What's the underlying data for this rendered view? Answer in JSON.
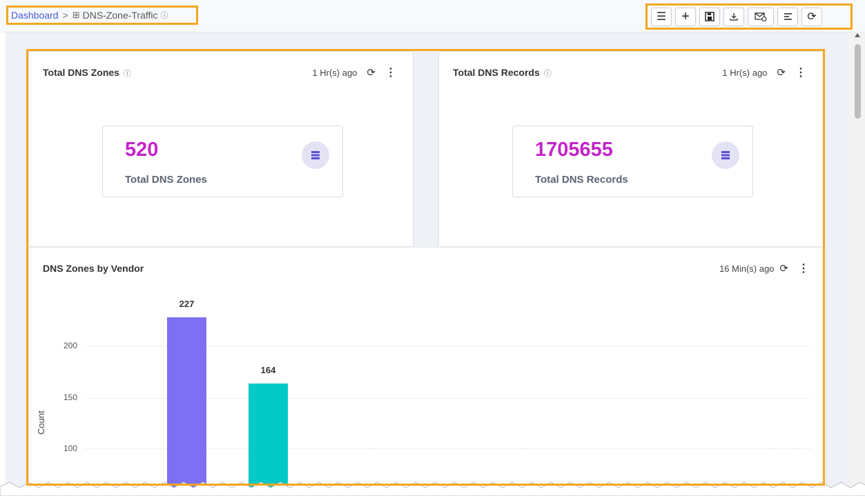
{
  "breadcrumb": {
    "root": "Dashboard",
    "separator": ">",
    "current": "DNS-Zone-Traffic"
  },
  "toolbar": {
    "buttons": [
      "menu-icon",
      "add-icon",
      "save-icon",
      "download-icon",
      "email-schedule-icon",
      "list-icon",
      "refresh-icon"
    ]
  },
  "cards": [
    {
      "title": "Total DNS Zones",
      "updated": "1 Hr(s) ago",
      "value": "520",
      "label": "Total DNS Zones"
    },
    {
      "title": "Total DNS Records",
      "updated": "1 Hr(s) ago",
      "value": "1705655",
      "label": "Total DNS Records"
    }
  ],
  "chart_card": {
    "title": "DNS Zones by Vendor",
    "updated": "16 Min(s) ago"
  },
  "colors": {
    "accent": "#c324c9",
    "bar1": "#7f6ff2",
    "bar2": "#00c9c6",
    "highlight": "#f5a623"
  },
  "chart_data": {
    "type": "bar",
    "values": [
      227,
      164
    ],
    "value_labels": [
      "227",
      "164"
    ],
    "colors": [
      "#7f6ff2",
      "#00c9c6"
    ],
    "ylabel": "Count",
    "yticks": [
      "200",
      "150",
      "100"
    ],
    "grid": true
  }
}
